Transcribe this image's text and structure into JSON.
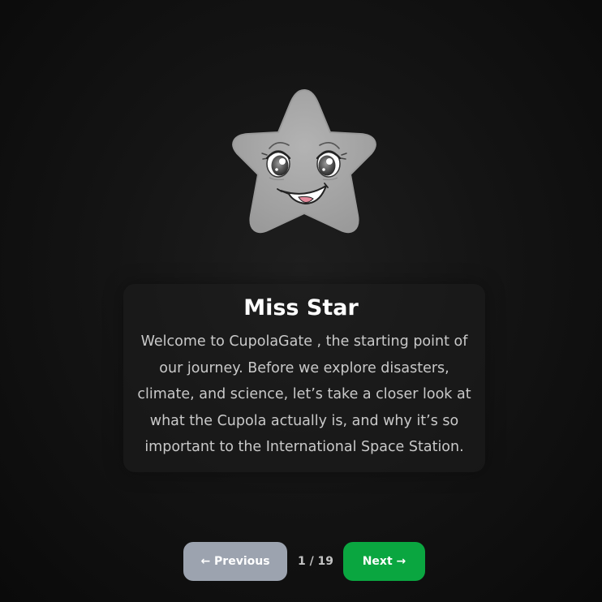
{
  "character": {
    "name": "Miss Star",
    "image_icon": "smiling-star-mascot-icon"
  },
  "card": {
    "text": "Welcome to CupolaGate , the starting point of our journey. Before we explore disasters, climate, and science, let’s take a closer look at what the Cupola actually is, and why it’s so important to the International Space Station."
  },
  "navigation": {
    "previous_label": "← Previous",
    "next_label": "Next →",
    "page_indicator": "1 / 19",
    "current_page": 1,
    "total_pages": 19
  },
  "colors": {
    "background": "#121212",
    "previous_button": "#9ca3af",
    "next_button": "#0aa640",
    "title_text": "#ffffff",
    "body_text": "#c9c9c9",
    "star_fill": "#a6a6a6"
  }
}
